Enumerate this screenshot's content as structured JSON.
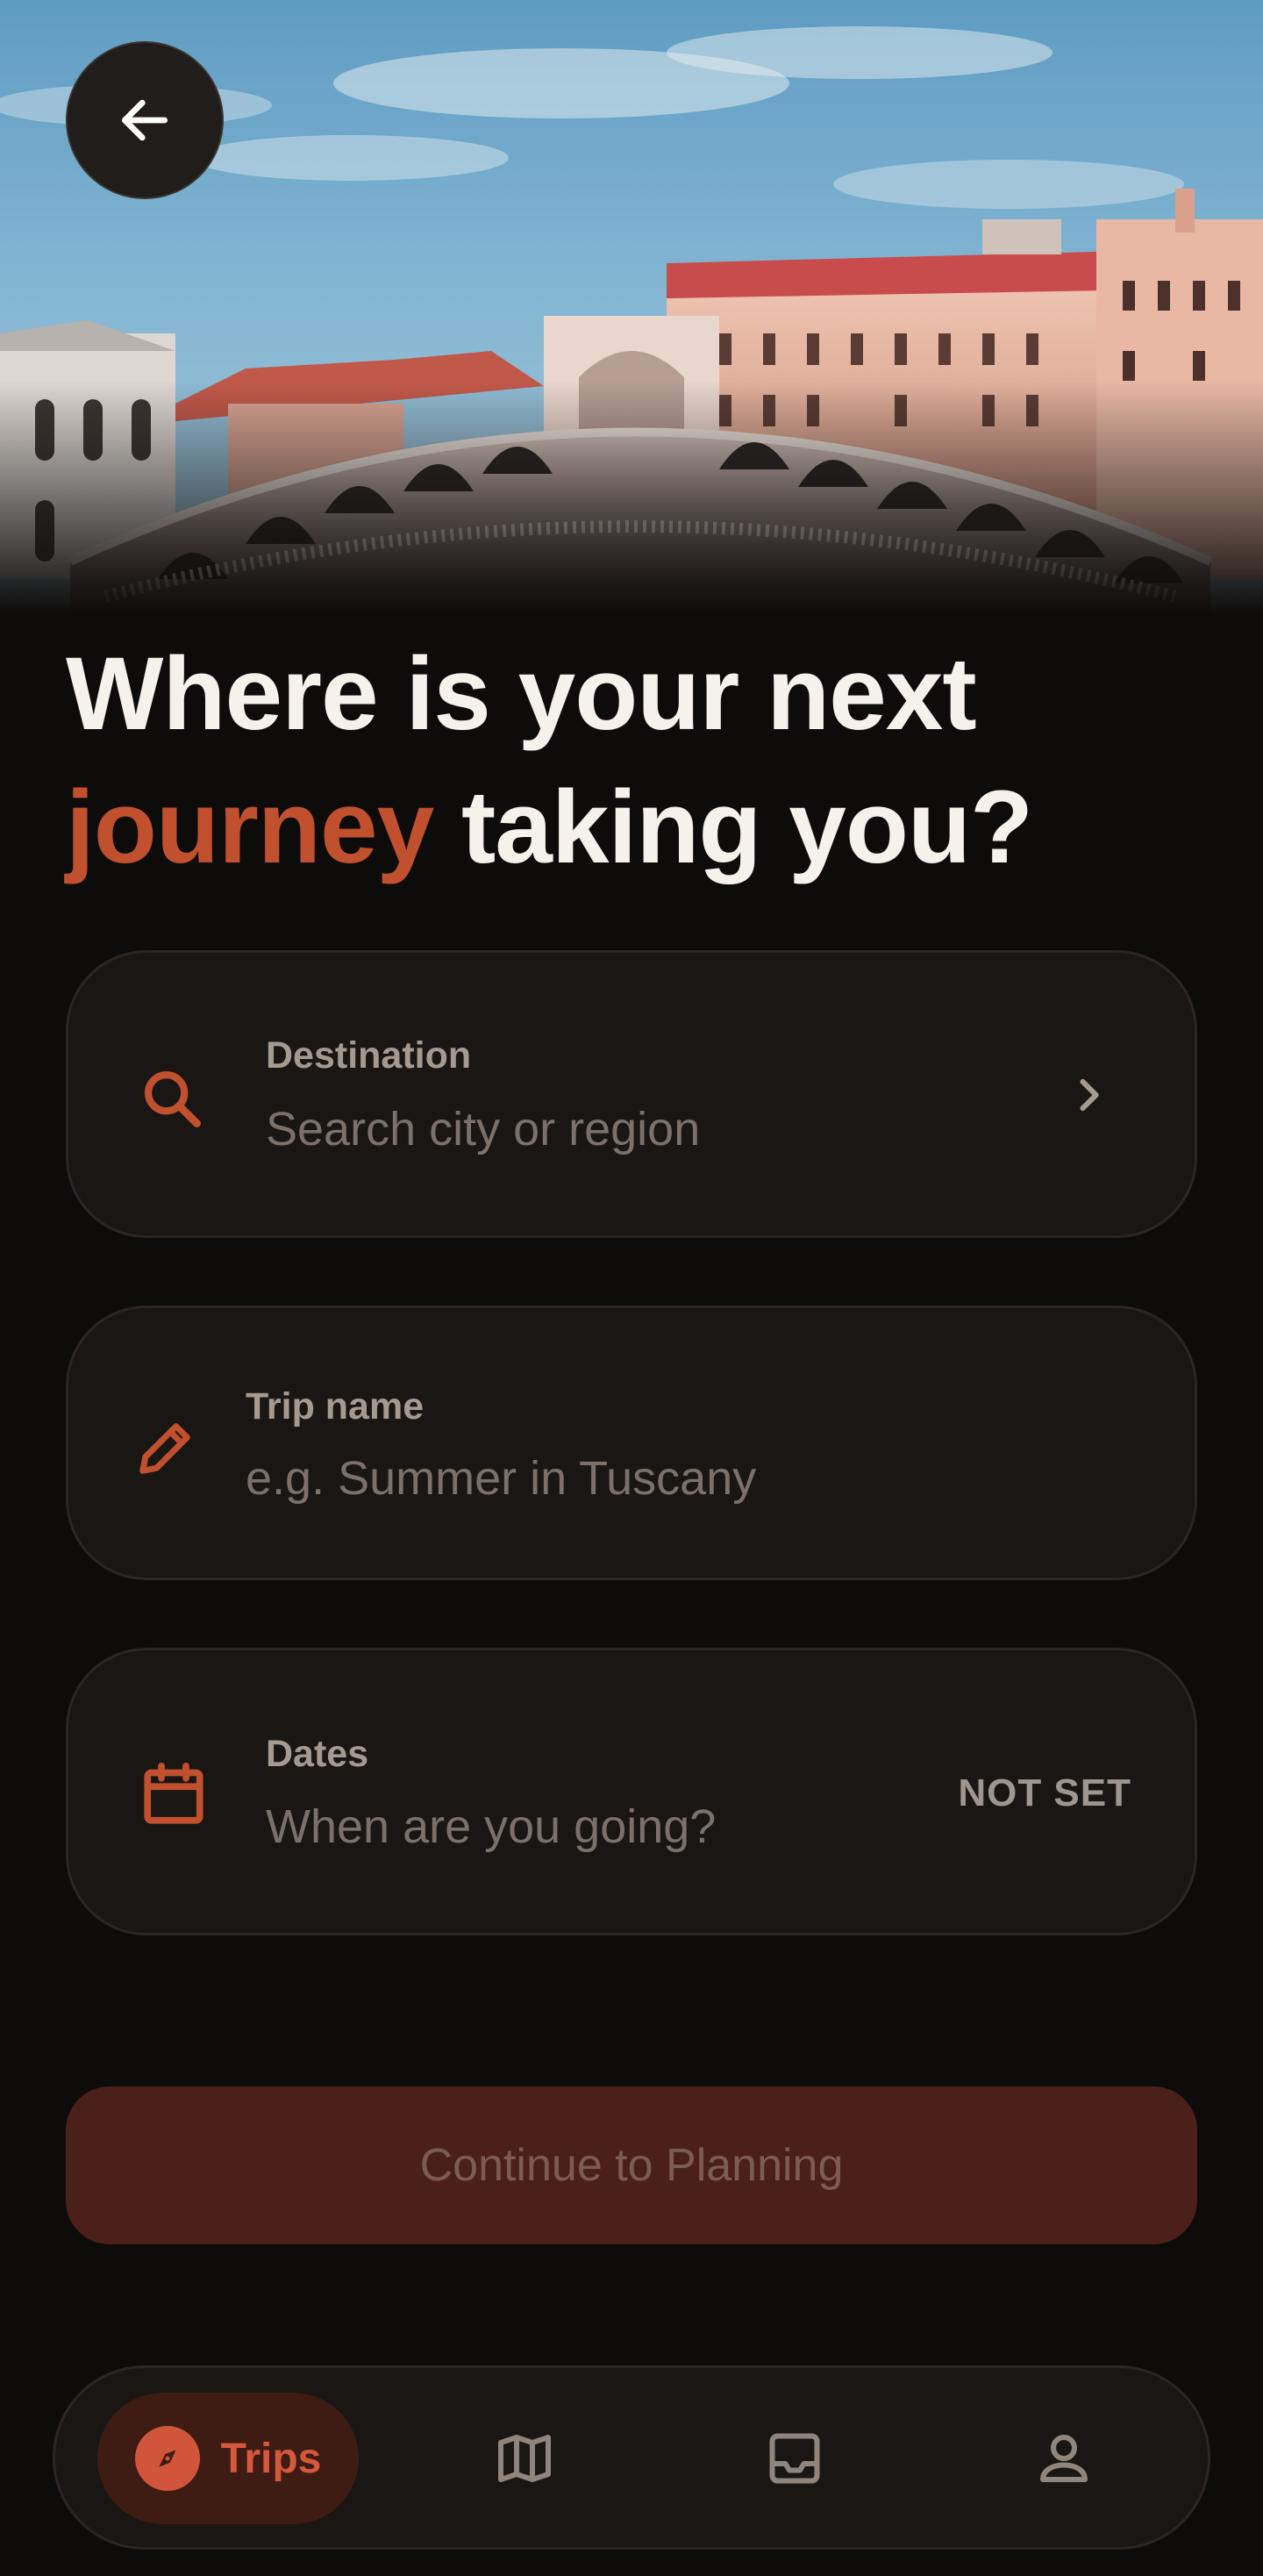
{
  "header": {
    "back_icon": "arrow-left-icon",
    "hero_image": "venice-rialto-bridge-photo"
  },
  "title": {
    "line1": "Where is your next",
    "accent": "journey",
    "rest": "taking you?"
  },
  "fields": {
    "destination": {
      "icon": "search-icon",
      "label": "Destination",
      "placeholder": "Search city or region",
      "trailing_icon": "chevron-right-icon"
    },
    "trip_name": {
      "icon": "pencil-icon",
      "label": "Trip name",
      "placeholder": "e.g. Summer in Tuscany"
    },
    "dates": {
      "icon": "calendar-icon",
      "label": "Dates",
      "placeholder": "When are you going?",
      "status": "NOT SET"
    }
  },
  "cta": {
    "label": "Continue to Planning"
  },
  "nav": {
    "items": [
      {
        "id": "trips",
        "label": "Trips",
        "icon": "compass-icon",
        "active": true
      },
      {
        "id": "map",
        "label": "",
        "icon": "map-icon",
        "active": false
      },
      {
        "id": "inbox",
        "label": "",
        "icon": "inbox-icon",
        "active": false
      },
      {
        "id": "profile",
        "label": "",
        "icon": "user-icon",
        "active": false
      }
    ]
  },
  "colors": {
    "background": "#0e0c0b",
    "card": "#1a1613",
    "accent": "#c1502e",
    "cta_disabled": "#4b2019",
    "nav_active": "#3e1c14"
  }
}
